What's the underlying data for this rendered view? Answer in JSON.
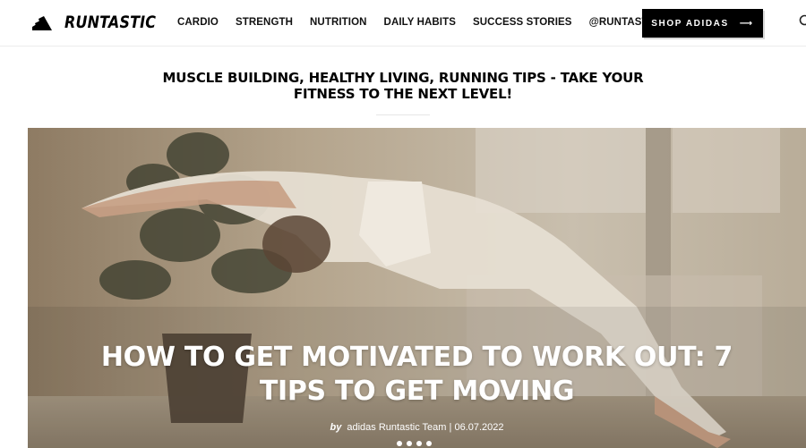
{
  "header": {
    "logo_text": "RUNTASTIC",
    "nav": [
      "CARDIO",
      "STRENGTH",
      "NUTRITION",
      "DAILY HABITS",
      "SUCCESS STORIES",
      "@RUNTASTIC"
    ],
    "shop_button": "SHOP ADIDAS",
    "shop_arrow": "⟶"
  },
  "tagline": "MUSCLE BUILDING, HEALTHY LIVING, RUNNING TIPS - TAKE YOUR FITNESS TO THE NEXT LEVEL!",
  "hero": {
    "title": "HOW TO GET MOTIVATED TO WORK OUT: 7 TIPS TO GET MOVING",
    "byline_prefix": "by",
    "author": "adidas Runtastic Team",
    "separator": "|",
    "date": "06.07.2022",
    "slides": 4
  },
  "colors": {
    "brand": "#000000",
    "button_text": "#ffffff",
    "hero_text": "#ffffff"
  }
}
